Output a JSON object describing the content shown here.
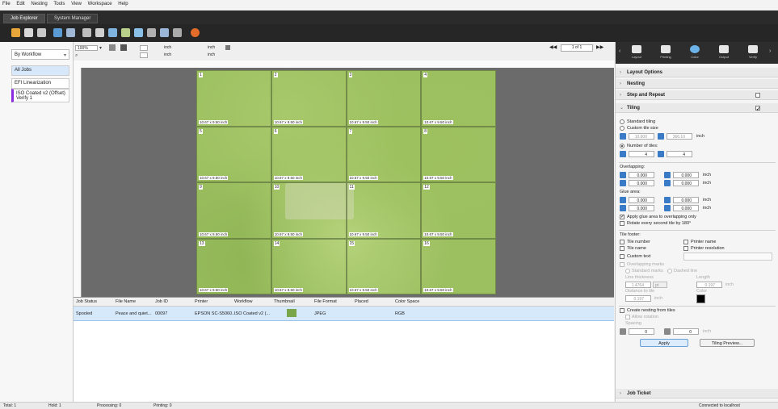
{
  "menu": [
    "File",
    "Edit",
    "Nesting",
    "Tools",
    "View",
    "Workspace",
    "Help"
  ],
  "tabs": [
    "Job Explorer",
    "System Manager"
  ],
  "left": {
    "workflow_select": "By Workflow",
    "items": [
      "All Jobs",
      "EFI Linearization",
      "ISO Coated v2 (Offset) Verify 1"
    ]
  },
  "canvas_toolbar": {
    "zoom": "100%",
    "unit1": "inch",
    "unit2": "inch",
    "unit3": "inch",
    "unit4": "inch"
  },
  "pager": "1 of 1",
  "tiles": [
    {
      "n": "1",
      "size": "10.67 x 9.50 inch"
    },
    {
      "n": "2",
      "size": "10.67 x 9.50 inch"
    },
    {
      "n": "3",
      "size": "10.67 x 9.50 inch"
    },
    {
      "n": "4",
      "size": "10.67 x 9.50 inch"
    },
    {
      "n": "5",
      "size": "10.67 x 9.50 inch"
    },
    {
      "n": "6",
      "size": "10.67 x 9.50 inch"
    },
    {
      "n": "7",
      "size": "10.67 x 9.50 inch"
    },
    {
      "n": "8",
      "size": "10.67 x 9.50 inch"
    },
    {
      "n": "9",
      "size": "10.67 x 9.50 inch"
    },
    {
      "n": "10",
      "size": "10.67 x 9.50 inch"
    },
    {
      "n": "11",
      "size": "10.67 x 9.50 inch"
    },
    {
      "n": "12",
      "size": "10.67 x 9.50 inch"
    },
    {
      "n": "13",
      "size": "10.67 x 9.50 inch"
    },
    {
      "n": "14",
      "size": "10.67 x 9.50 inch"
    },
    {
      "n": "15",
      "size": "10.67 x 9.50 inch"
    },
    {
      "n": "16",
      "size": "10.67 x 9.50 inch"
    }
  ],
  "job_table": {
    "headers": [
      "Job Status",
      "File Name",
      "Job ID",
      "Printer",
      "Workflow",
      "Thumbnail",
      "File Format",
      "Placed",
      "Color Space"
    ],
    "row": {
      "status": "Spooled",
      "file_name": "Peace and quiet...",
      "job_id": "00097",
      "printer": "EPSON SC-S5060...",
      "workflow": "ISO Coated v2 (...",
      "file_format": "JPEG",
      "placed": "",
      "color_space": "RGB"
    }
  },
  "right": {
    "tabs": [
      "Layout",
      "Printing",
      "Color",
      "Output",
      "Verify"
    ],
    "sections": {
      "layout_options": "Layout Options",
      "nesting": "Nesting",
      "step_repeat": "Step and Repeat",
      "tiling": "Tiling",
      "job_ticket": "Job Ticket"
    },
    "tiling": {
      "standard_tiling": "Standard tiling",
      "custom_tile_size": "Custom tile size",
      "tile_w": "10.600",
      "tile_h": "366.10",
      "unit_inch": "inch",
      "number_of_tiles": "Number of tiles:",
      "tiles_x": "4",
      "tiles_y": "4",
      "overlapping": "Overlapping:",
      "ov_vals": [
        "0.000",
        "0.000",
        "0.000",
        "0.000"
      ],
      "glue_area": "Glue area:",
      "glue_vals": [
        "0.000",
        "0.000",
        "0.000",
        "0.000"
      ],
      "apply_glue": "Apply glue area to overlapping only",
      "rotate_every": "Rotate every second tile by 180°",
      "tile_footer": "Tile footer:",
      "tile_number": "Tile number",
      "printer_name": "Printer name",
      "tile_name": "Tile name",
      "printer_resolution": "Printer resolution",
      "custom_text": "Custom text",
      "overlapping_marks": "Overlapping marks",
      "standard_marks": "Standard marks",
      "dashed_line": "Dashed line",
      "line_thickness": "Line thickness",
      "length": "Length",
      "lt_val": "1.4764",
      "lt_unit": "pt",
      "len_val": "0.197",
      "distance_to_tile": "Distance to tile",
      "dist_val": "0.197",
      "color": "Color",
      "create_nesting": "Create nesting from tiles",
      "allow_rotation": "Allow rotation",
      "spacing": "Spacing",
      "sp_val1": "0",
      "sp_val2": "0",
      "apply": "Apply",
      "tiling_preview": "Tiling Preview..."
    }
  },
  "status": {
    "total": "Total: 1",
    "hold": "Hold: 1",
    "processing": "Processing: 0",
    "printing": "Printing: 0",
    "connection": "Connected to localhost"
  }
}
